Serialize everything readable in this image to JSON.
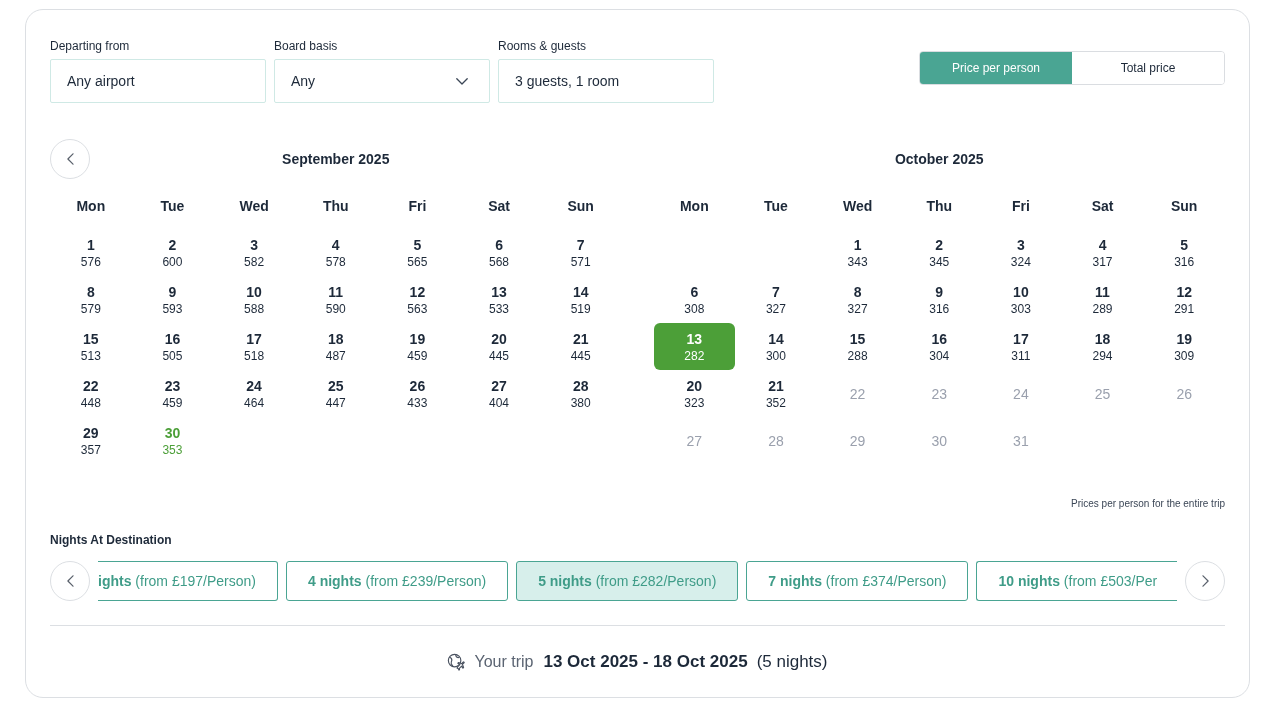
{
  "filters": [
    {
      "label": "Departing from",
      "value": "Any airport",
      "kind": "text"
    },
    {
      "label": "Board basis",
      "value": "Any",
      "kind": "dropdown"
    },
    {
      "label": "Rooms & guests",
      "value": "3 guests, 1 room",
      "kind": "text"
    }
  ],
  "price_toggle": {
    "options": [
      {
        "label": "Price per person",
        "selected": true
      },
      {
        "label": "Total price",
        "selected": false
      }
    ]
  },
  "calendars": [
    {
      "title": "September 2025",
      "weekdays": [
        "Mon",
        "Tue",
        "Wed",
        "Thu",
        "Fri",
        "Sat",
        "Sun"
      ],
      "weeks": [
        [
          {
            "day": "1",
            "price": "576",
            "available": true,
            "highlighted": false,
            "selected": false
          },
          {
            "day": "2",
            "price": "600",
            "available": true,
            "highlighted": false,
            "selected": false
          },
          {
            "day": "3",
            "price": "582",
            "available": true,
            "highlighted": false,
            "selected": false
          },
          {
            "day": "4",
            "price": "578",
            "available": true,
            "highlighted": false,
            "selected": false
          },
          {
            "day": "5",
            "price": "565",
            "available": true,
            "highlighted": false,
            "selected": false
          },
          {
            "day": "6",
            "price": "568",
            "available": true,
            "highlighted": false,
            "selected": false
          },
          {
            "day": "7",
            "price": "571",
            "available": true,
            "highlighted": false,
            "selected": false
          }
        ],
        [
          {
            "day": "8",
            "price": "579",
            "available": true,
            "highlighted": false,
            "selected": false
          },
          {
            "day": "9",
            "price": "593",
            "available": true,
            "highlighted": false,
            "selected": false
          },
          {
            "day": "10",
            "price": "588",
            "available": true,
            "highlighted": false,
            "selected": false
          },
          {
            "day": "11",
            "price": "590",
            "available": true,
            "highlighted": false,
            "selected": false
          },
          {
            "day": "12",
            "price": "563",
            "available": true,
            "highlighted": false,
            "selected": false
          },
          {
            "day": "13",
            "price": "533",
            "available": true,
            "highlighted": false,
            "selected": false
          },
          {
            "day": "14",
            "price": "519",
            "available": true,
            "highlighted": false,
            "selected": false
          }
        ],
        [
          {
            "day": "15",
            "price": "513",
            "available": true,
            "highlighted": false,
            "selected": false
          },
          {
            "day": "16",
            "price": "505",
            "available": true,
            "highlighted": false,
            "selected": false
          },
          {
            "day": "17",
            "price": "518",
            "available": true,
            "highlighted": false,
            "selected": false
          },
          {
            "day": "18",
            "price": "487",
            "available": true,
            "highlighted": false,
            "selected": false
          },
          {
            "day": "19",
            "price": "459",
            "available": true,
            "highlighted": false,
            "selected": false
          },
          {
            "day": "20",
            "price": "445",
            "available": true,
            "highlighted": false,
            "selected": false
          },
          {
            "day": "21",
            "price": "445",
            "available": true,
            "highlighted": false,
            "selected": false
          }
        ],
        [
          {
            "day": "22",
            "price": "448",
            "available": true,
            "highlighted": false,
            "selected": false
          },
          {
            "day": "23",
            "price": "459",
            "available": true,
            "highlighted": false,
            "selected": false
          },
          {
            "day": "24",
            "price": "464",
            "available": true,
            "highlighted": false,
            "selected": false
          },
          {
            "day": "25",
            "price": "447",
            "available": true,
            "highlighted": false,
            "selected": false
          },
          {
            "day": "26",
            "price": "433",
            "available": true,
            "highlighted": false,
            "selected": false
          },
          {
            "day": "27",
            "price": "404",
            "available": true,
            "highlighted": false,
            "selected": false
          },
          {
            "day": "28",
            "price": "380",
            "available": true,
            "highlighted": false,
            "selected": false
          }
        ],
        [
          {
            "day": "29",
            "price": "357",
            "available": true,
            "highlighted": false,
            "selected": false
          },
          {
            "day": "30",
            "price": "353",
            "available": true,
            "highlighted": true,
            "selected": false
          }
        ]
      ]
    },
    {
      "title": "October 2025",
      "weekdays": [
        "Mon",
        "Tue",
        "Wed",
        "Thu",
        "Fri",
        "Sat",
        "Sun"
      ],
      "weeks": [
        [
          {
            "day": "1",
            "price": "343",
            "available": true,
            "highlighted": false,
            "selected": false
          },
          {
            "day": "2",
            "price": "345",
            "available": true,
            "highlighted": false,
            "selected": false
          },
          {
            "day": "3",
            "price": "324",
            "available": true,
            "highlighted": false,
            "selected": false
          },
          {
            "day": "4",
            "price": "317",
            "available": true,
            "highlighted": false,
            "selected": false
          },
          {
            "day": "5",
            "price": "316",
            "available": true,
            "highlighted": false,
            "selected": false
          }
        ],
        [
          {
            "day": "6",
            "price": "308",
            "available": true,
            "highlighted": false,
            "selected": false
          },
          {
            "day": "7",
            "price": "327",
            "available": true,
            "highlighted": false,
            "selected": false
          },
          {
            "day": "8",
            "price": "327",
            "available": true,
            "highlighted": false,
            "selected": false
          },
          {
            "day": "9",
            "price": "316",
            "available": true,
            "highlighted": false,
            "selected": false
          },
          {
            "day": "10",
            "price": "303",
            "available": true,
            "highlighted": false,
            "selected": false
          },
          {
            "day": "11",
            "price": "289",
            "available": true,
            "highlighted": false,
            "selected": false
          },
          {
            "day": "12",
            "price": "291",
            "available": true,
            "highlighted": false,
            "selected": false
          }
        ],
        [
          {
            "day": "13",
            "price": "282",
            "available": true,
            "highlighted": false,
            "selected": true
          },
          {
            "day": "14",
            "price": "300",
            "available": true,
            "highlighted": false,
            "selected": false
          },
          {
            "day": "15",
            "price": "288",
            "available": true,
            "highlighted": false,
            "selected": false
          },
          {
            "day": "16",
            "price": "304",
            "available": true,
            "highlighted": false,
            "selected": false
          },
          {
            "day": "17",
            "price": "311",
            "available": true,
            "highlighted": false,
            "selected": false
          },
          {
            "day": "18",
            "price": "294",
            "available": true,
            "highlighted": false,
            "selected": false
          },
          {
            "day": "19",
            "price": "309",
            "available": true,
            "highlighted": false,
            "selected": false
          }
        ],
        [
          {
            "day": "20",
            "price": "323",
            "available": true,
            "highlighted": false,
            "selected": false
          },
          {
            "day": "21",
            "price": "352",
            "available": true,
            "highlighted": false,
            "selected": false
          },
          {
            "day": "22",
            "available": false
          },
          {
            "day": "23",
            "available": false
          },
          {
            "day": "24",
            "available": false
          },
          {
            "day": "25",
            "available": false
          },
          {
            "day": "26",
            "available": false
          }
        ],
        [
          {
            "day": "27",
            "available": false
          },
          {
            "day": "28",
            "available": false
          },
          {
            "day": "29",
            "available": false
          },
          {
            "day": "30",
            "available": false
          },
          {
            "day": "31",
            "available": false
          }
        ]
      ]
    }
  ],
  "prices_note": "Prices per person for the entire trip",
  "nights": {
    "title": "Nights At Destination",
    "options": [
      {
        "label": "**ights** (from £197/Person)",
        "selected": false
      },
      {
        "label": "**4 nights** (from £239/Person)",
        "selected": false
      },
      {
        "label": "**5 nights** (from £282/Person)",
        "selected": true
      },
      {
        "label": "**7 nights** (from £374/Person)",
        "selected": false
      },
      {
        "label": "**10 nights** (from £503/Per",
        "selected": false
      }
    ]
  },
  "trip": {
    "label": "Your trip",
    "dates": "13 Oct 2025 - 18 Oct 2025",
    "duration": "(5 nights)"
  }
}
